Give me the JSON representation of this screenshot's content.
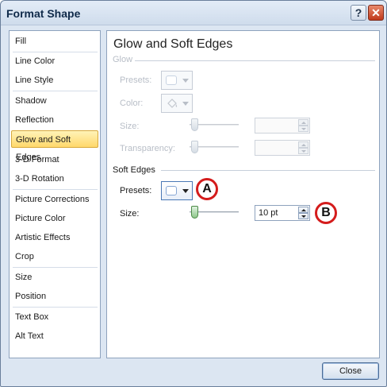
{
  "window": {
    "title": "Format Shape",
    "help_glyph": "?",
    "close_glyph": "✕"
  },
  "nav": {
    "items": [
      "Fill",
      "Line Color",
      "Line Style",
      "Shadow",
      "Reflection",
      "Glow and Soft Edges",
      "3-D Format",
      "3-D Rotation",
      "Picture Corrections",
      "Picture Color",
      "Artistic Effects",
      "Crop",
      "Size",
      "Position",
      "Text Box",
      "Alt Text"
    ],
    "selected": "Glow and Soft Edges"
  },
  "content": {
    "heading": "Glow and Soft Edges",
    "glow": {
      "group_label": "Glow",
      "presets_label": "Presets:",
      "color_label": "Color:",
      "size_label": "Size:",
      "transparency_label": "Transparency:"
    },
    "soft_edges": {
      "group_label": "Soft Edges",
      "presets_label": "Presets:",
      "size_label": "Size:",
      "size_value": "10 pt"
    },
    "callouts": {
      "a": "A",
      "b": "B"
    }
  },
  "footer": {
    "close_label": "Close"
  }
}
